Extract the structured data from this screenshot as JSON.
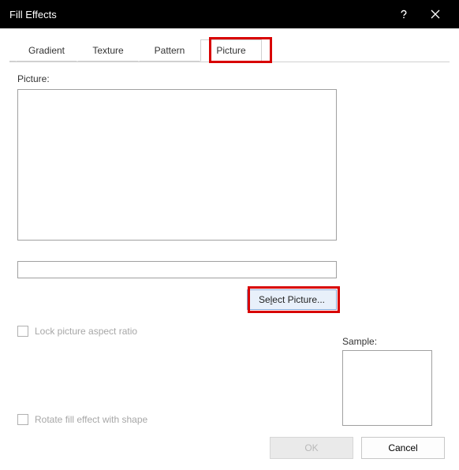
{
  "title": "Fill Effects",
  "tabs": {
    "gradient": "Gradient",
    "texture": "Texture",
    "pattern": "Pattern",
    "picture": "Picture",
    "active_index": 3
  },
  "labels": {
    "picture": "Picture:",
    "sample": "Sample:"
  },
  "picture_name_value": "",
  "select_picture_prefix": "Se",
  "select_picture_underline": "l",
  "select_picture_suffix": "ect Picture...",
  "checkboxes": {
    "lock_aspect": "Lock picture aspect ratio",
    "rotate": "Rotate fill effect with shape"
  },
  "buttons": {
    "ok": "OK",
    "cancel": "Cancel"
  },
  "highlight_color": "#d80000"
}
